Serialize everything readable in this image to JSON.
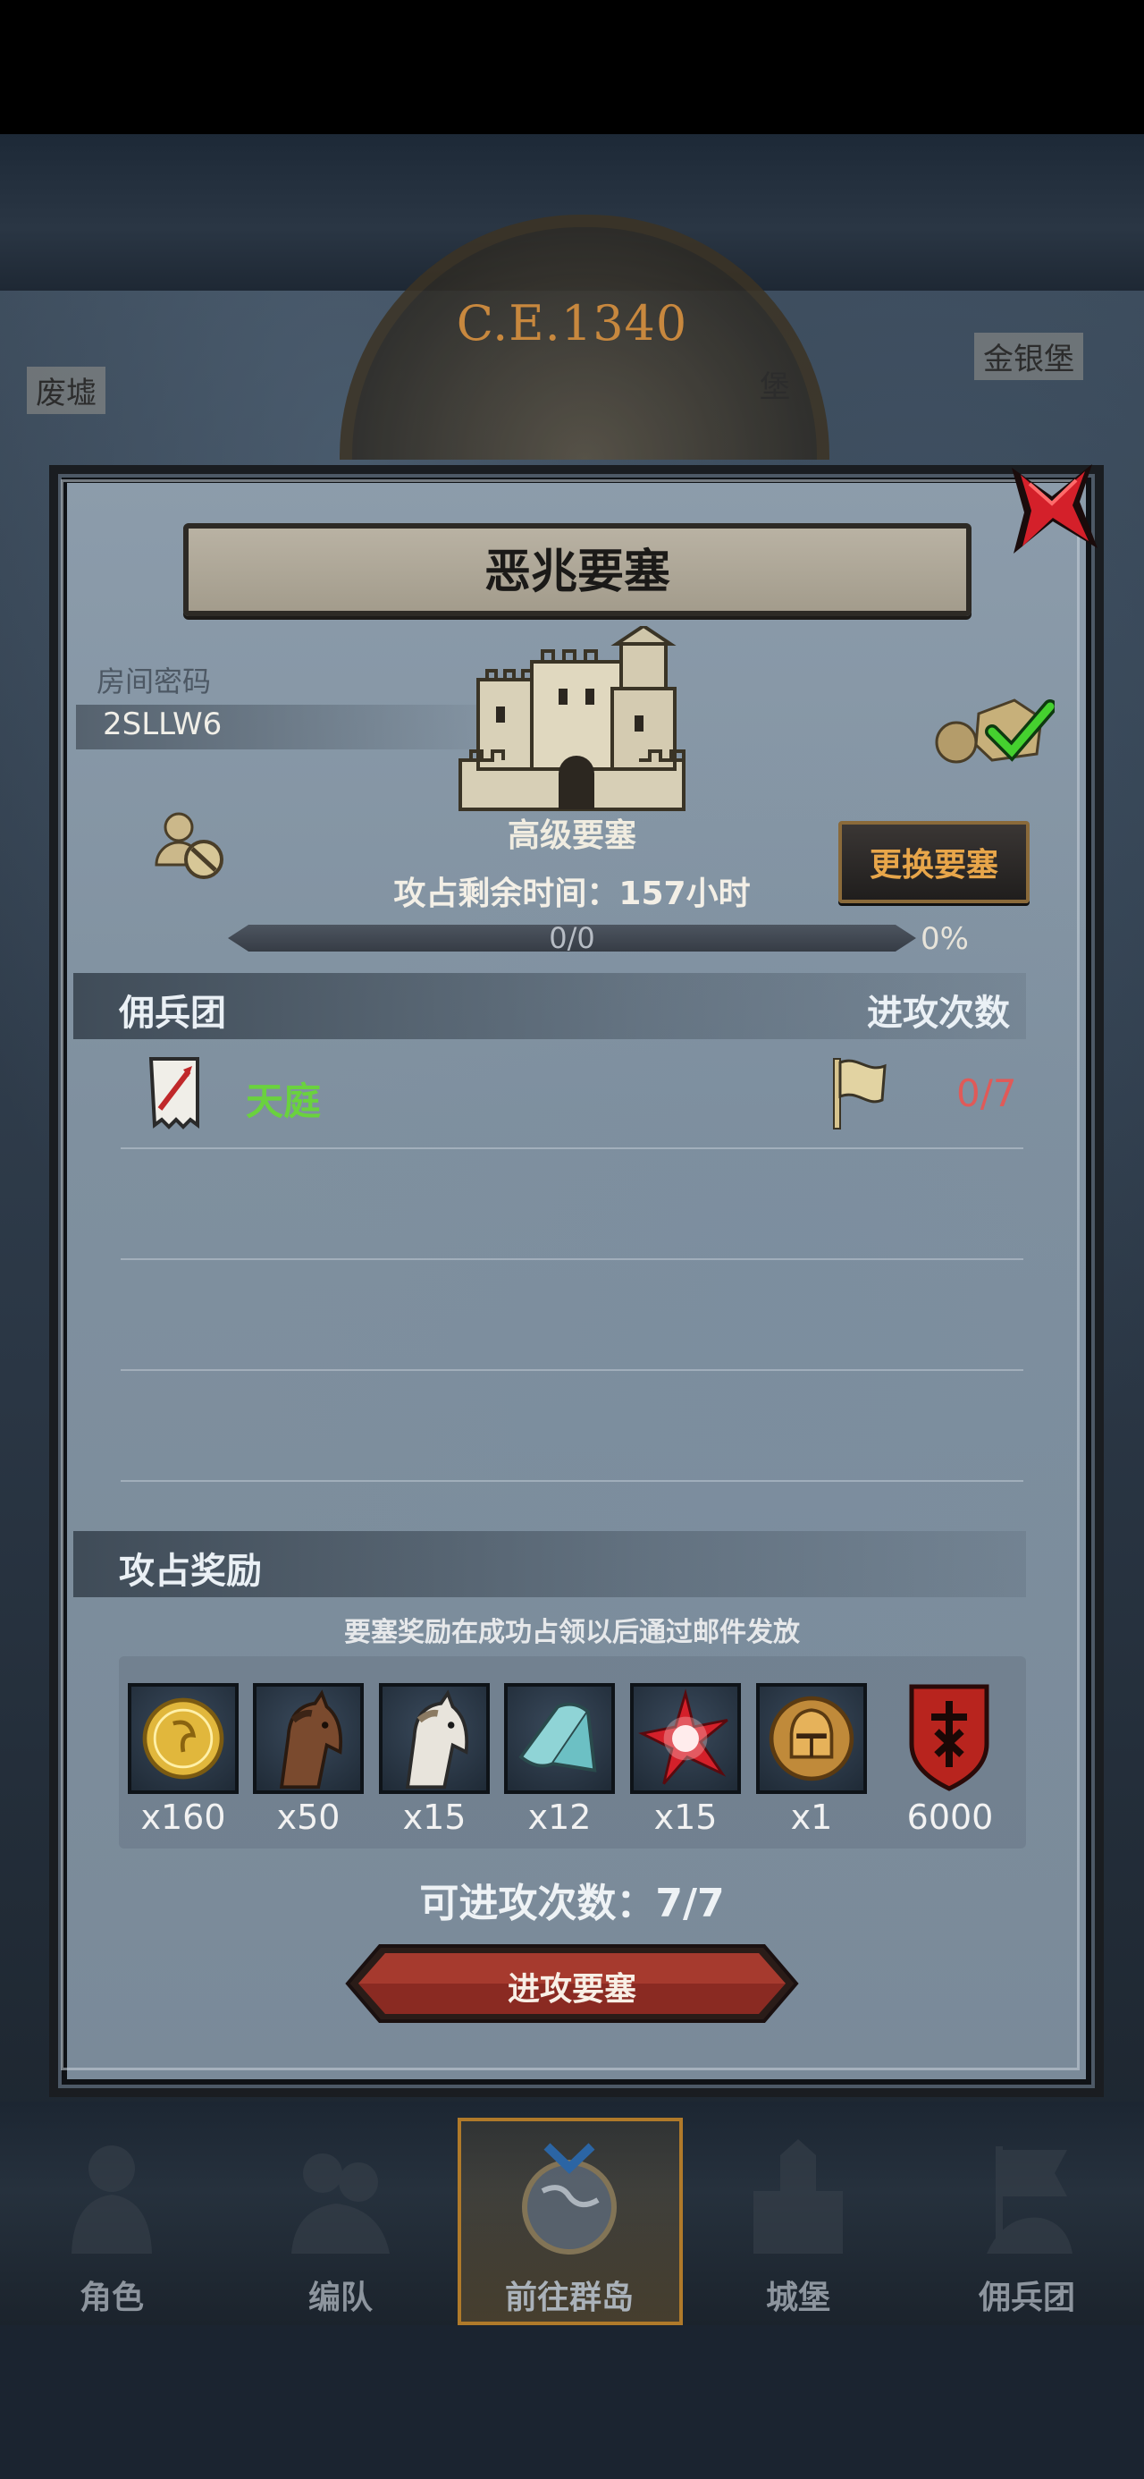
{
  "background": {
    "era": "C.E.1340",
    "map_labels": [
      "废墟",
      "堡",
      "金银堡"
    ]
  },
  "dialog": {
    "title": "恶兆要塞",
    "room_code_label": "房间密码",
    "room_code": "2SLLW6",
    "fortress_level": "高级要塞",
    "change_button": "更换要塞",
    "remaining_time": "攻占剩余时间：157小时",
    "progress": {
      "count": "0/0",
      "percent": "0%",
      "fraction": 0
    },
    "mercenary_header": "佣兵团",
    "attack_count_header": "进攻次数",
    "mercenaries": [
      {
        "name": "天庭",
        "attacks": "0/7"
      }
    ],
    "reward_header": "攻占奖励",
    "reward_note": "要塞奖励在成功占领以后通过邮件发放",
    "rewards": [
      {
        "icon": "gold-coin-icon",
        "qty": "x160"
      },
      {
        "icon": "brown-horse-icon",
        "qty": "x50"
      },
      {
        "icon": "white-horse-icon",
        "qty": "x15"
      },
      {
        "icon": "cloth-roll-icon",
        "qty": "x12"
      },
      {
        "icon": "red-star-gem-icon",
        "qty": "x15"
      },
      {
        "icon": "knight-helmet-coin-icon",
        "qty": "x1"
      },
      {
        "icon": "red-shield-emblem-icon",
        "qty": "6000"
      }
    ],
    "attacks_available": "可进攻次数：7/7",
    "attack_button": "进攻要塞"
  },
  "nav": {
    "items": [
      {
        "label": "角色",
        "icon": "knight-icon"
      },
      {
        "label": "编队",
        "icon": "formation-icon"
      },
      {
        "label": "前往群岛",
        "icon": "globe-icon",
        "active": true
      },
      {
        "label": "城堡",
        "icon": "castle-icon"
      },
      {
        "label": "佣兵团",
        "icon": "mercenary-icon"
      }
    ]
  },
  "colors": {
    "accent_gold": "#e8a64a",
    "mercenary_green": "#6ad23e",
    "attacks_red": "#e05a58",
    "close_red": "#d4202a"
  }
}
